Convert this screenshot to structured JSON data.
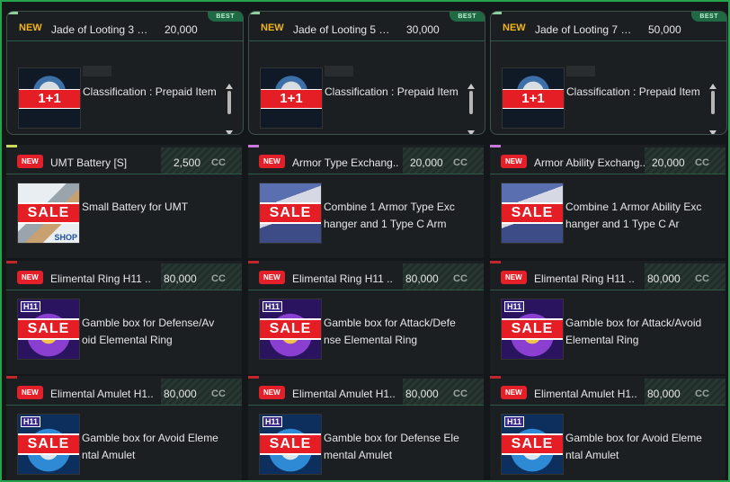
{
  "colors": {
    "frame": "#25a34a",
    "sale": "#e51e25",
    "new_badge": "#e3202a",
    "new_text": "#f0b31e",
    "best_badge": "#1f6a45"
  },
  "featured": [
    {
      "new_label": "NEW",
      "best_label": "BEST",
      "title": "Jade of Looting 3 Da..",
      "price": "20,000",
      "badge": "1+1",
      "desc": "Classification : Prepaid Item",
      "accent": "#8fd19e",
      "icon": "jade-disc-icon"
    },
    {
      "new_label": "NEW",
      "best_label": "BEST",
      "title": "Jade of Looting 5 Da..",
      "price": "30,000",
      "badge": "1+1",
      "desc": "Classification : Prepaid Item",
      "accent": "#8fd19e",
      "icon": "jade-disc-icon"
    },
    {
      "new_label": "NEW",
      "best_label": "BEST",
      "title": "Jade of Looting 7 Da..",
      "price": "50,000",
      "badge": "1+1",
      "desc": "Classification : Prepaid Item",
      "accent": "#8fd19e",
      "icon": "jade-disc-icon"
    }
  ],
  "items": [
    {
      "new_label": "NEW",
      "title": "UMT Battery [S]",
      "price": "2,500",
      "currency": "CC",
      "sale": "SALE",
      "desc": "Small Battery for UMT",
      "accent": "#c9d85a",
      "icon": "battery-icon",
      "shop": "SHOP"
    },
    {
      "new_label": "NEW",
      "title": "Armor Type Exchang..",
      "price": "20,000",
      "currency": "CC",
      "sale": "SALE",
      "desc": "Combine 1 Armor Type Exchanger and 1 Type C Arm",
      "accent": "#c47ad6",
      "icon": "armor-exchanger-icon"
    },
    {
      "new_label": "NEW",
      "title": "Armor Ability Exchang..",
      "price": "20,000",
      "currency": "CC",
      "sale": "SALE",
      "desc": "Combine 1 Armor Ability Exchanger and 1 Type C Ar",
      "accent": "#c47ad6",
      "icon": "armor-exchanger-icon"
    },
    {
      "new_label": "NEW",
      "title": "Elimental Ring H11 ..",
      "price": "80,000",
      "currency": "CC",
      "sale": "SALE",
      "h11": "H11",
      "desc": "Gamble box for Defense/Avoid Elemental Ring",
      "accent": "#c0262b",
      "icon": "elemental-ring-icon"
    },
    {
      "new_label": "NEW",
      "title": "Elimental Ring H11 ..",
      "price": "80,000",
      "currency": "CC",
      "sale": "SALE",
      "h11": "H11",
      "desc": "Gamble box for Attack/Defense Elemental Ring",
      "accent": "#c0262b",
      "icon": "elemental-ring-icon"
    },
    {
      "new_label": "NEW",
      "title": "Elimental Ring H11 ..",
      "price": "80,000",
      "currency": "CC",
      "sale": "SALE",
      "h11": "H11",
      "desc": "Gamble box for Attack/Avoid Elemental Ring",
      "accent": "#c0262b",
      "icon": "elemental-ring-icon"
    },
    {
      "new_label": "NEW",
      "title": "Elimental Amulet H1..",
      "price": "80,000",
      "currency": "CC",
      "sale": "SALE",
      "h11": "H11",
      "desc": "Gamble box for Avoid Elemental Amulet",
      "accent": "#c0262b",
      "icon": "elemental-amulet-icon"
    },
    {
      "new_label": "NEW",
      "title": "Elimental Amulet H1..",
      "price": "80,000",
      "currency": "CC",
      "sale": "SALE",
      "h11": "H11",
      "desc": "Gamble box for Defense Elemental Amulet",
      "accent": "#c0262b",
      "icon": "elemental-amulet-icon"
    },
    {
      "new_label": "NEW",
      "title": "Elimental Amulet H1..",
      "price": "80,000",
      "currency": "CC",
      "sale": "SALE",
      "h11": "H11",
      "desc": "Gamble box for Avoid Elemental Amulet",
      "accent": "#c0262b",
      "icon": "elemental-amulet-icon"
    }
  ]
}
